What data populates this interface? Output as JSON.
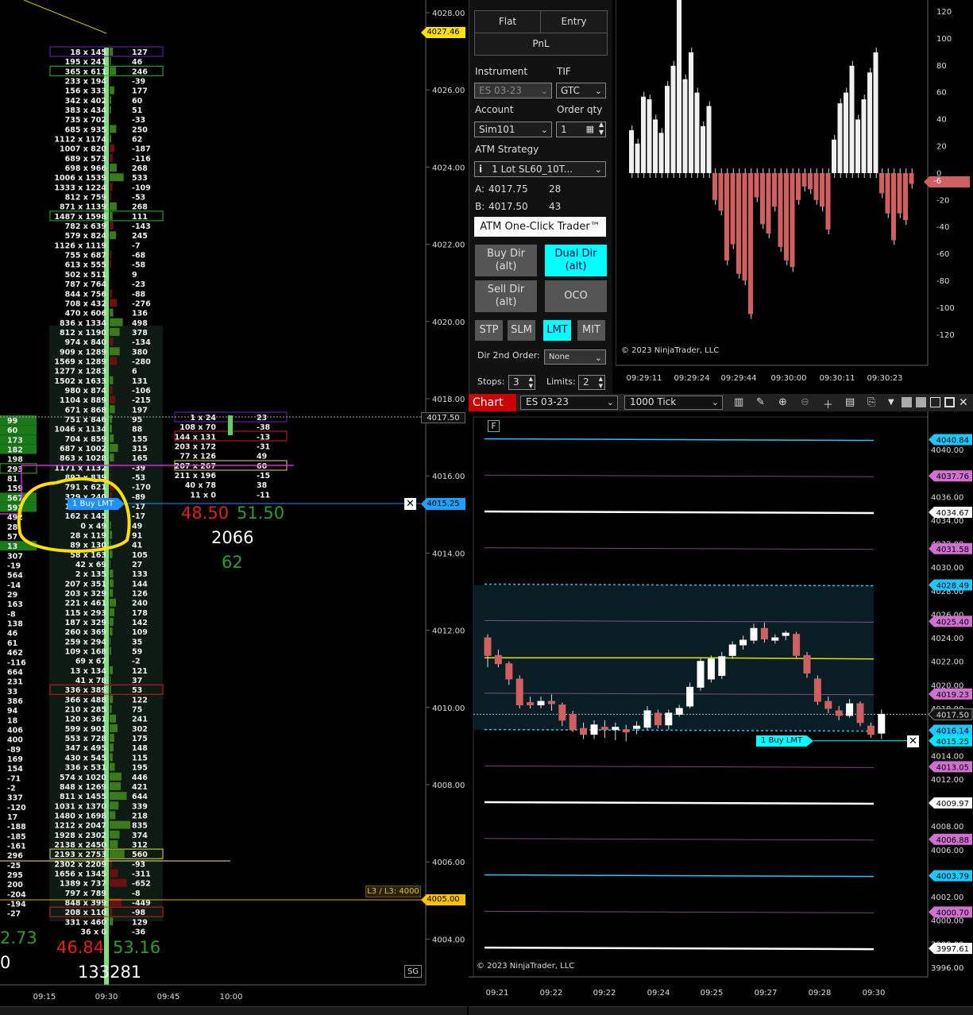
{
  "left_chart": {
    "price_labels": [
      "4028.00",
      "4026.00",
      "4024.00",
      "4022.00",
      "4020.00",
      "4018.00",
      "4016.00",
      "4014.00",
      "4012.00",
      "4010.00",
      "4008.00",
      "4006.00",
      "4004.00"
    ],
    "current_high_tag": "4027.46",
    "last_price_tag": "4017.50",
    "order_price_tag": "4015.25",
    "l3_label": "L3 / L3: 4000",
    "l3_price_tag": "4005.00",
    "time_labels": [
      "09:15",
      "09:30",
      "09:45",
      "10:00"
    ],
    "footprint_rows": [
      [
        "18 x 145",
        "127"
      ],
      [
        "195 x 241",
        "46"
      ],
      [
        "365 x 611",
        "246"
      ],
      [
        "233 x 194",
        "-39"
      ],
      [
        "156 x 333",
        "177"
      ],
      [
        "342 x 402",
        "60"
      ],
      [
        "383 x 434",
        "51"
      ],
      [
        "735 x 702",
        "-33"
      ],
      [
        "685 x 935",
        "250"
      ],
      [
        "1112 x 1174",
        "62"
      ],
      [
        "1007 x 820",
        "-187"
      ],
      [
        "689 x 573",
        "-116"
      ],
      [
        "698 x 966",
        "268"
      ],
      [
        "1006 x 1539",
        "533"
      ],
      [
        "1333 x 1224",
        "-109"
      ],
      [
        "812 x 759",
        "-53"
      ],
      [
        "871 x 1139",
        "268"
      ],
      [
        "1487 x 1598",
        "111"
      ],
      [
        "782 x 639",
        "-143"
      ],
      [
        "579 x 824",
        "245"
      ],
      [
        "1126 x 1119",
        "-7"
      ],
      [
        "755 x 687",
        "-68"
      ],
      [
        "613 x 555",
        "-58"
      ],
      [
        "502 x 511",
        "9"
      ],
      [
        "787 x 764",
        "-23"
      ],
      [
        "844 x 756",
        "-88"
      ],
      [
        "708 x 432",
        "-276"
      ],
      [
        "470 x 606",
        "136"
      ],
      [
        "836 x 1334",
        "498"
      ],
      [
        "812 x 1190",
        "378"
      ],
      [
        "974 x 840",
        "-134"
      ],
      [
        "909 x 1289",
        "380"
      ],
      [
        "1569 x 1289",
        "-280"
      ],
      [
        "1277 x 1283",
        "6"
      ],
      [
        "1502 x 1633",
        "131"
      ],
      [
        "980 x 874",
        "-106"
      ],
      [
        "1104 x 889",
        "-215"
      ],
      [
        "671 x 868",
        "197"
      ],
      [
        "751 x 846",
        "95"
      ],
      [
        "1046 x 1134",
        "88"
      ],
      [
        "704 x 859",
        "155"
      ],
      [
        "687 x 1002",
        "315"
      ],
      [
        "863 x 1028",
        "165"
      ],
      [
        "1171 x 1132",
        "-39"
      ],
      [
        "892 x 839",
        "-53"
      ],
      [
        "791 x 621",
        "-170"
      ],
      [
        "329 x 240",
        "-89"
      ],
      [
        "162 x 145",
        "-17"
      ],
      [
        "162 x 145",
        "-17"
      ],
      [
        "0 x 49",
        "49"
      ],
      [
        "28 x 119",
        "91"
      ],
      [
        "89 x 130",
        "41"
      ],
      [
        "58 x 163",
        "105"
      ],
      [
        "42 x 69",
        "27"
      ],
      [
        "2 x 135",
        "133"
      ],
      [
        "207 x 351",
        "144"
      ],
      [
        "203 x 329",
        "126"
      ],
      [
        "221 x 461",
        "240"
      ],
      [
        "115 x 293",
        "178"
      ],
      [
        "187 x 329",
        "142"
      ],
      [
        "260 x 369",
        "109"
      ],
      [
        "259 x 294",
        "35"
      ],
      [
        "109 x 168",
        "59"
      ],
      [
        "69 x 67",
        "-2"
      ],
      [
        "13 x 134",
        "121"
      ],
      [
        "41 x 78",
        "37"
      ],
      [
        "336 x 389",
        "53"
      ],
      [
        "366 x 488",
        "122"
      ],
      [
        "210 x 285",
        "75"
      ],
      [
        "120 x 361",
        "241"
      ],
      [
        "599 x 901",
        "302"
      ],
      [
        "553 x 728",
        "175"
      ],
      [
        "347 x 495",
        "148"
      ],
      [
        "430 x 545",
        "115"
      ],
      [
        "336 x 531",
        "195"
      ],
      [
        "574 x 1020",
        "446"
      ],
      [
        "848 x 1269",
        "421"
      ],
      [
        "811 x 1455",
        "644"
      ],
      [
        "1031 x 1370",
        "339"
      ],
      [
        "1480 x 1698",
        "218"
      ],
      [
        "1212 x 2047",
        "835"
      ],
      [
        "1928 x 2302",
        "374"
      ],
      [
        "2138 x 2450",
        "312"
      ],
      [
        "2193 x 2753",
        "560"
      ],
      [
        "2302 x 2209",
        "-93"
      ],
      [
        "1656 x 1345",
        "-311"
      ],
      [
        "1389 x 737",
        "-652"
      ],
      [
        "797 x 789",
        "-8"
      ],
      [
        "848 x 399",
        "-449"
      ],
      [
        "208 x 110",
        "-98"
      ],
      [
        "331 x 460",
        "129"
      ],
      [
        "36 x 0",
        "-36"
      ]
    ],
    "prev_column_values": [
      "99",
      "60",
      "173",
      "182",
      "198",
      "293",
      "81",
      "159",
      "567",
      "593",
      "492",
      "28",
      "57",
      "13",
      "307",
      "-19",
      "564",
      "-14",
      "29",
      "163",
      "-8",
      "138",
      "46",
      "61",
      "462",
      "-116",
      "664",
      "231",
      "33",
      "386",
      "94",
      "18",
      "406",
      "400",
      "-89",
      "169",
      "154",
      "-71",
      "-2",
      "337",
      "-120",
      "17",
      "-188",
      "-185",
      "-161",
      "296",
      "-25",
      "295",
      "200",
      "-204",
      "-194",
      "-27"
    ],
    "second_footprint_rows": [
      [
        "1 x 24",
        "23"
      ],
      [
        "108 x 70",
        "-38"
      ],
      [
        "144 x 131",
        "-13"
      ],
      [
        "203 x 172",
        "-31"
      ],
      [
        "77 x 126",
        "49"
      ],
      [
        "207 x 267",
        "60"
      ],
      [
        "211 x 196",
        "-15"
      ],
      [
        "40 x 78",
        "38"
      ],
      [
        "11 x 0",
        "-11"
      ]
    ],
    "order_label": "1  Buy LMT",
    "stats_bid_pct": "48.50",
    "stats_ask_pct": "51.50",
    "stats_volume": "2066",
    "stats_delta": "62",
    "bottom_bid_pct": "46.84",
    "bottom_ask_pct": "53.16",
    "bottom_volume": "133281",
    "bottom_left_partial_top": "2.73",
    "bottom_left_partial_bottom": "0",
    "sg_label": "SG"
  },
  "panel": {
    "flat": "Flat",
    "entry": "Entry",
    "pnl": "PnL",
    "instrument_label": "Instrument",
    "instrument_value": "ES 03-23",
    "tif_label": "TIF",
    "tif_value": "GTC",
    "account_label": "Account",
    "account_value": "Sim101",
    "orderqty_label": "Order qty",
    "orderqty_value": "1",
    "atm_label": "ATM Strategy",
    "atm_value": "1 Lot  SL60_10T...",
    "ask_label": "A:",
    "ask_price": "4017.75",
    "ask_size": "28",
    "bid_label": "B:",
    "bid_price": "4017.50",
    "bid_size": "43",
    "one_click": "ATM One-Click Trader™",
    "buy_dir": "Buy Dir\n(alt)",
    "dual_dir": "Dual Dir\n(alt)",
    "sell_dir": "Sell Dir\n(alt)",
    "oco": "OCO",
    "stp": "STP",
    "slm": "SLM",
    "lmt": "LMT",
    "mit": "MIT",
    "dir2_label": "Dir 2nd Order:",
    "dir2_value": "None",
    "stops_label": "Stops:",
    "stops_value": "3",
    "limits_label": "Limits:",
    "limits_value": "2"
  },
  "top_chart": {
    "y_labels": [
      "120",
      "100",
      "80",
      "60",
      "40",
      "20",
      "0",
      "-20",
      "-40",
      "-60",
      "-80",
      "-100",
      "-120"
    ],
    "current_tag": "-6",
    "copyright": "© 2023 NinjaTrader, LLC",
    "time_labels": [
      "09:29:11",
      "09:29:24",
      "09:29:44",
      "09:30:00",
      "09:30:11",
      "09:30:23"
    ]
  },
  "bottom_chart": {
    "tab_label": "Chart",
    "instrument": "ES 03-23",
    "interval": "1000 Tick",
    "y_labels": [
      "4040.00",
      "4038.00",
      "4036.00",
      "4034.00",
      "4032.00",
      "4030.00",
      "4028.00",
      "4026.00",
      "4024.00",
      "4022.00",
      "4020.00",
      "4018.00",
      "4016.00",
      "4014.00",
      "4012.00",
      "4010.00",
      "4008.00",
      "4006.00",
      "4004.00",
      "4002.00",
      "4000.00",
      "3998.00",
      "3996.00"
    ],
    "tags": [
      {
        "value": "4040.84",
        "color": "#1ec8ff"
      },
      {
        "value": "4037.76",
        "color": "#d070d0"
      },
      {
        "value": "4034.67",
        "color": "#ffffff"
      },
      {
        "value": "4031.58",
        "color": "#d070d0"
      },
      {
        "value": "4028.49",
        "color": "#1ec8ff"
      },
      {
        "value": "4025.40",
        "color": "#d070d0"
      },
      {
        "value": "4019.23",
        "color": "#d070d0"
      },
      {
        "value": "4017.50",
        "color": "#222222"
      },
      {
        "value": "4016.14",
        "color": "#1ec8ff"
      },
      {
        "value": "4015.25",
        "color": "#00e5ff"
      },
      {
        "value": "4013.05",
        "color": "#d070d0"
      },
      {
        "value": "4009.97",
        "color": "#ffffff"
      },
      {
        "value": "4006.88",
        "color": "#d070d0"
      },
      {
        "value": "4003.79",
        "color": "#1ec8ff"
      },
      {
        "value": "4000.70",
        "color": "#d070d0"
      },
      {
        "value": "3997.61",
        "color": "#ffffff"
      }
    ],
    "order_label": "1  Buy LMT",
    "copyright": "© 2023 NinjaTrader, LLC",
    "time_labels": [
      "09:21",
      "09:22",
      "09:22",
      "09:24",
      "09:25",
      "09:27",
      "09:28",
      "09:30"
    ],
    "f_button": "F"
  }
}
